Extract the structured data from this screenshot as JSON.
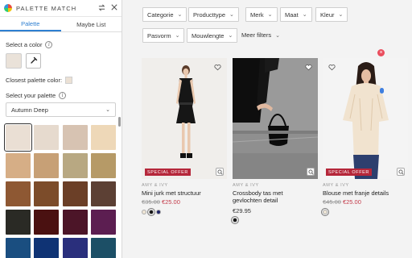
{
  "panel": {
    "title": "PALETTE MATCH",
    "tabs": [
      "Palette",
      "Maybe List"
    ],
    "select_color_label": "Select a color",
    "closest_label": "Closest palette color:",
    "select_palette_label": "Select your palette",
    "palette_value": "Autumn Deep",
    "selected_color": "#eae2d9",
    "swatches": [
      "#eadfd4",
      "#e6dace",
      "#d7c3b2",
      "#eed8b8",
      "#d6ae86",
      "#c7a076",
      "#b8a882",
      "#b69a67",
      "#8e5833",
      "#7c4c2a",
      "#6b3f27",
      "#5c4034",
      "#2a2a25",
      "#4a1111",
      "#4c1528",
      "#5c1e51",
      "#1a4e80",
      "#0f3374",
      "#2a2f7c",
      "#1c4f66"
    ]
  },
  "filters": [
    "Categorie",
    "Producttype",
    "Merk",
    "Maat",
    "Kleur",
    "Pasvorm",
    "Mouwlengte"
  ],
  "more_filters": "Meer filters",
  "products": [
    {
      "badge": "SPECIAL OFFER",
      "brand": "AMY & IVY",
      "name": "Mini jurk met structuur",
      "old_price": "€35.00",
      "price": "€25.00",
      "colors": [
        "#efe6d6",
        "#111111",
        "#1f2466"
      ],
      "img_bg": "#f0eeeb"
    },
    {
      "badge": "",
      "brand": "AMY & IVY",
      "name": "Crossbody tas met gevlochten detail",
      "old_price": "",
      "price": "€29.95",
      "colors": [
        "#111111"
      ],
      "img_bg": "#8f8f8f"
    },
    {
      "badge": "SPECIAL OFFER",
      "brand": "AMY & IVY",
      "name": "Blouse met franje details",
      "old_price": "€45.00",
      "price": "€25.00",
      "colors": [
        "#efe6d6"
      ],
      "img_bg": "#f4f4f4"
    }
  ],
  "icons": {
    "logo": "palette-logo-icon",
    "swap": "swap-icon",
    "close": "close-icon",
    "dropper": "eyedropper-icon",
    "heart": "heart-icon",
    "zoom": "zoom-icon"
  },
  "accent": "#2e7fd1",
  "sale_color": "#b5273a"
}
